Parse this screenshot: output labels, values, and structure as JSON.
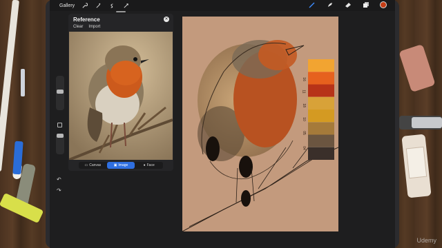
{
  "app": {
    "gallery_label": "Gallery",
    "left_tools": [
      "wrench-icon",
      "magic-wand-icon",
      "selection-icon",
      "transform-icon"
    ],
    "right_tools": [
      "brush-icon",
      "smudge-icon",
      "eraser-icon",
      "layers-icon"
    ],
    "current_color": "#c43d16",
    "accent_color": "#2f6fe0"
  },
  "reference": {
    "title": "Reference",
    "clear_label": "Clear",
    "import_label": "Import",
    "tabs": [
      {
        "label": "Canvas",
        "icon": "canvas-icon",
        "active": false
      },
      {
        "label": "Image",
        "icon": "image-icon",
        "active": true
      },
      {
        "label": "Face",
        "icon": "face-icon",
        "active": false
      }
    ]
  },
  "palette": {
    "swatch_colors": [
      "#f2a431",
      "#e6611e",
      "#b73318",
      "#d8a238",
      "#d49a22",
      "#a57a3a",
      "#6b5540",
      "#3a2f2a"
    ],
    "labels": [
      "16",
      "11",
      "18",
      "10",
      "05",
      "04"
    ]
  },
  "watermark": "Udemy"
}
